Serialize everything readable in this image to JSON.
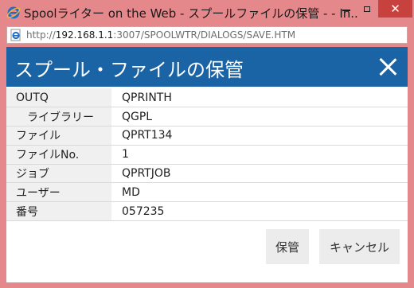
{
  "window": {
    "title": "Spoolライター on the Web - スプールファイルの保管 - - In...",
    "close_glyph": "✕"
  },
  "address": {
    "prefix": "http://",
    "host": "192.168.1.1",
    "path": ":3007/SPOOLWTR/DIALOGS/SAVE.HTM"
  },
  "dialog": {
    "title": "スプール・ファイルの保管",
    "fields": [
      {
        "label": "OUTQ",
        "value": "QPRINTH"
      },
      {
        "label": "ライブラリー",
        "value": "QGPL"
      },
      {
        "label": "ファイル",
        "value": "QPRT134"
      },
      {
        "label": "ファイルNo.",
        "value": "1"
      },
      {
        "label": "ジョブ",
        "value": "QPRTJOB"
      },
      {
        "label": "ユーザー",
        "value": "MD"
      },
      {
        "label": "番号",
        "value": "057235"
      }
    ],
    "save_label": "保管",
    "cancel_label": "キャンセル"
  },
  "colors": {
    "window_frame": "#e5888b",
    "header_bg": "#1a63a5",
    "close_button": "#c7413f",
    "label_bg": "#f0f0f0",
    "button_bg": "#ececec"
  },
  "icons": {
    "browser": "ie-icon",
    "address_page": "ie-page-icon"
  }
}
